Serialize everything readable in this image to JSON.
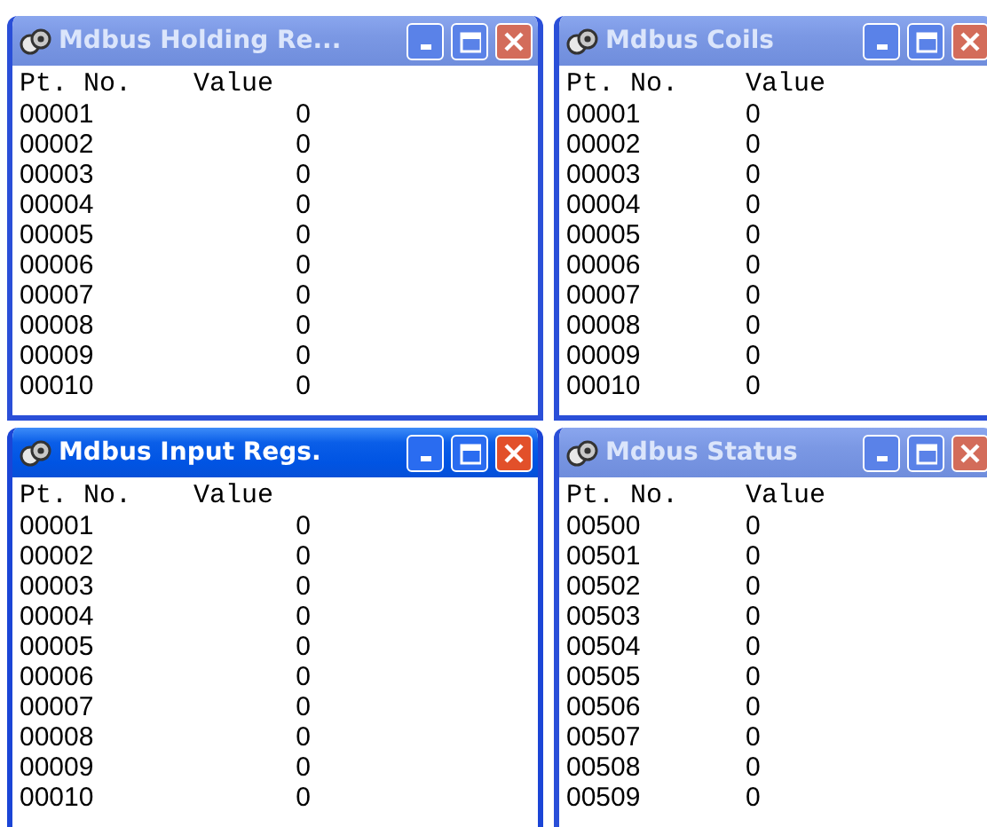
{
  "windows": [
    {
      "title": "Mdbus Holding Re...",
      "active": false,
      "columns": [
        "Pt. No.",
        "Value"
      ],
      "rows": [
        [
          "00001",
          "0"
        ],
        [
          "00002",
          "0"
        ],
        [
          "00003",
          "0"
        ],
        [
          "00004",
          "0"
        ],
        [
          "00005",
          "0"
        ],
        [
          "00006",
          "0"
        ],
        [
          "00007",
          "0"
        ],
        [
          "00008",
          "0"
        ],
        [
          "00009",
          "0"
        ],
        [
          "00010",
          "0"
        ]
      ]
    },
    {
      "title": "Mdbus Coils",
      "active": false,
      "columns": [
        "Pt. No.",
        "Value"
      ],
      "rows": [
        [
          "00001",
          "0"
        ],
        [
          "00002",
          "0"
        ],
        [
          "00003",
          "0"
        ],
        [
          "00004",
          "0"
        ],
        [
          "00005",
          "0"
        ],
        [
          "00006",
          "0"
        ],
        [
          "00007",
          "0"
        ],
        [
          "00008",
          "0"
        ],
        [
          "00009",
          "0"
        ],
        [
          "00010",
          "0"
        ]
      ]
    },
    {
      "title": "Mdbus Input Regs.",
      "active": true,
      "columns": [
        "Pt. No.",
        "Value"
      ],
      "rows": [
        [
          "00001",
          "0"
        ],
        [
          "00002",
          "0"
        ],
        [
          "00003",
          "0"
        ],
        [
          "00004",
          "0"
        ],
        [
          "00005",
          "0"
        ],
        [
          "00006",
          "0"
        ],
        [
          "00007",
          "0"
        ],
        [
          "00008",
          "0"
        ],
        [
          "00009",
          "0"
        ],
        [
          "00010",
          "0"
        ]
      ]
    },
    {
      "title": "Mdbus Status",
      "active": false,
      "columns": [
        "Pt. No.",
        "Value"
      ],
      "rows": [
        [
          "00500",
          "0"
        ],
        [
          "00501",
          "0"
        ],
        [
          "00502",
          "0"
        ],
        [
          "00503",
          "0"
        ],
        [
          "00504",
          "0"
        ],
        [
          "00505",
          "0"
        ],
        [
          "00506",
          "0"
        ],
        [
          "00507",
          "0"
        ],
        [
          "00508",
          "0"
        ],
        [
          "00509",
          "0"
        ]
      ]
    }
  ]
}
